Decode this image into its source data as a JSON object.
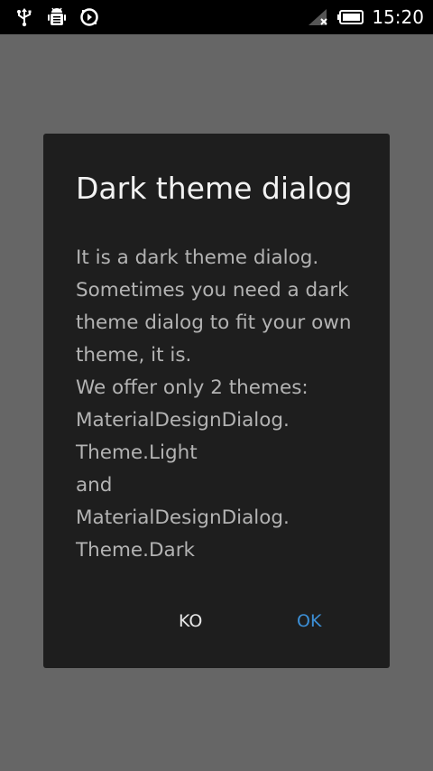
{
  "status_bar": {
    "left_icons": [
      "usb-icon",
      "android-debug-icon",
      "sync-icon"
    ],
    "right_icons": [
      "signal-no-service-icon",
      "battery-icon"
    ],
    "time": "15:20"
  },
  "dialog": {
    "title": "Dark theme dialog",
    "message_lines": [
      "It is a dark theme dialog.",
      "Sometimes you need a dark",
      "theme dialog to fit your own",
      "theme, it is.",
      "We offer only 2 themes:",
      "MaterialDesignDialog.",
      "Theme.Light",
      "and",
      "MaterialDesignDialog.",
      "Theme.Dark"
    ],
    "negative_button": "KO",
    "positive_button": "OK"
  },
  "colors": {
    "background_dim": "#666666",
    "dialog_background": "#1e1e1e",
    "title_text": "#f2f2f2",
    "message_text": "#b3b3b3",
    "negative_button_text": "#e6e6e6",
    "positive_button_text": "#3c8fd6"
  }
}
